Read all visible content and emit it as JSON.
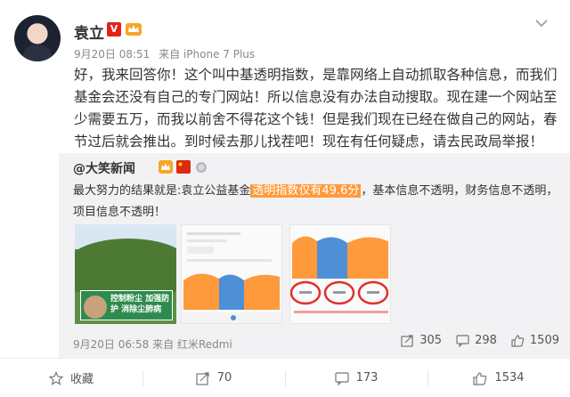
{
  "post": {
    "author": "袁立",
    "verified_badge": "V",
    "date": "9月20日 08:51",
    "source": "来自 iPhone 7 Plus",
    "text": "好，我来回答你！这个叫中基透明指数，是靠网络上自动抓取各种信息，而我们基金会还没有自己的专门网站！所以信息没有办法自动搜取。现在建一个网站至少需要五万，而我以前舍不得花这个钱！但是我们现在已经在做自己的网站，春节过后就会推出。到时候去那儿找茬吧！现在有任何疑虑，请去民政局举报！"
  },
  "repost": {
    "at": "@",
    "author": "大笑新闻",
    "text_before": "最大努力的结果就是:袁立公益基金",
    "text_highlight": "透明指数仅有49.6分",
    "text_after": "，基本信息不透明，财务信息不透明，项目信息不透明！",
    "thumb1_banner": "控制粉尘 加强防护 消除尘肺病",
    "date": "9月20日 06:58",
    "source": "来自 红米Redmi",
    "shares": "305",
    "comments": "298",
    "likes": "1509"
  },
  "actions": {
    "favorite": "收藏",
    "repost": "70",
    "comment": "173",
    "like": "1534"
  },
  "colors": {
    "verified": "#e2231a",
    "highlight": "#ff9a3c",
    "repost_bg": "#f2f2f5"
  }
}
